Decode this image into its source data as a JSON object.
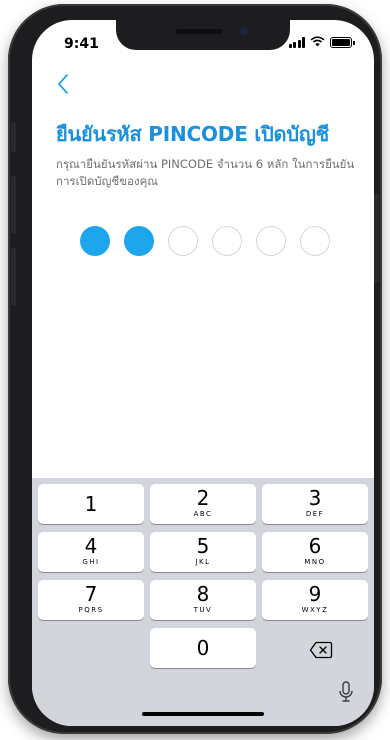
{
  "status": {
    "time": "9:41"
  },
  "header": {
    "back_icon": "chevron-left-icon",
    "title": "ยืนยันรหัส PINCODE เปิดบัญชี",
    "subtitle": "กรุณายืนยันรหัสผ่าน PINCODE จำนวน 6 หลัก ในการยืนยันการเปิดบัญชีของคุณ"
  },
  "pin": {
    "length": 6,
    "entered": 2,
    "fill_color": "#1ea6ec"
  },
  "keypad": {
    "keys": [
      {
        "num": "1",
        "letters": ""
      },
      {
        "num": "2",
        "letters": "ABC"
      },
      {
        "num": "3",
        "letters": "DEF"
      },
      {
        "num": "4",
        "letters": "GHI"
      },
      {
        "num": "5",
        "letters": "JKL"
      },
      {
        "num": "6",
        "letters": "MNO"
      },
      {
        "num": "7",
        "letters": "PQRS"
      },
      {
        "num": "8",
        "letters": "TUV"
      },
      {
        "num": "9",
        "letters": "WXYZ"
      },
      {
        "num": "0",
        "letters": ""
      }
    ],
    "delete_icon": "backspace-icon",
    "mic_icon": "microphone-icon"
  },
  "colors": {
    "accent": "#1c90d9",
    "keypad_bg": "#d2d5db"
  }
}
